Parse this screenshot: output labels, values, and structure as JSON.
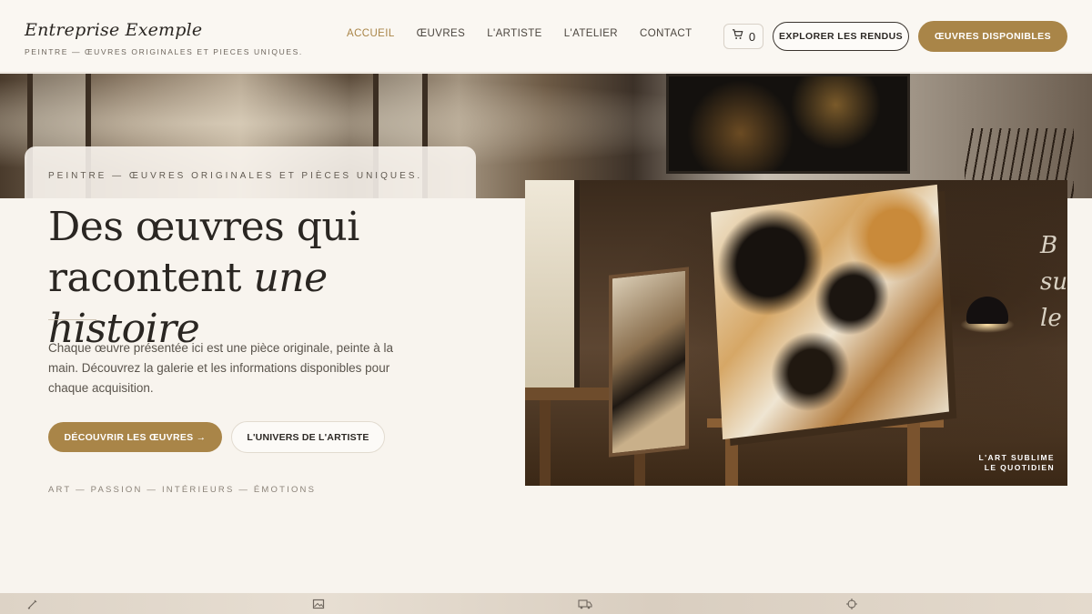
{
  "brand": {
    "name": "Entreprise Exemple",
    "tagline": "PEINTRE — ŒUVRES ORIGINALES ET PIECES UNIQUES."
  },
  "nav": {
    "items": [
      {
        "label": "ACCUEIL",
        "active": true
      },
      {
        "label": "ŒUVRES",
        "active": false
      },
      {
        "label": "L'ARTISTE",
        "active": false
      },
      {
        "label": "L'ATELIER",
        "active": false
      },
      {
        "label": "CONTACT",
        "active": false
      }
    ]
  },
  "header_actions": {
    "cart_icon": "cart-icon",
    "cart_count": "0",
    "explore_label": "EXPLORER LES RENDUS",
    "available_label": "ŒUVRES DISPONIBLES"
  },
  "hero": {
    "kicker": "PEINTRE — ŒUVRES ORIGINALES ET PIÈCES UNIQUES.",
    "title_line1": "Des œuvres qui",
    "title_line2_plain": "racontent ",
    "title_line2_italic": "une histoire",
    "lead": "Chaque œuvre présentée ici est une pièce originale, peinte à la main. Découvrez la galerie et les informations disponibles pour chaque acquisition.",
    "primary_cta": "DÉCOUVRIR LES ŒUVRES →",
    "secondary_cta": "L'UNIVERS DE L'ARTISTE",
    "tags": "ART — PASSION — INTÉRIEURS — ÉMOTIONS"
  },
  "hero_image": {
    "caption_line1": "L'ART SUBLIME",
    "caption_line2": "LE QUOTIDIEN"
  },
  "footer_icons": [
    "brush-icon",
    "image-icon",
    "truck-icon",
    "crosshair-icon"
  ],
  "colors": {
    "accent": "#a98548",
    "background": "#f8f4ee",
    "text": "#2c2824"
  }
}
